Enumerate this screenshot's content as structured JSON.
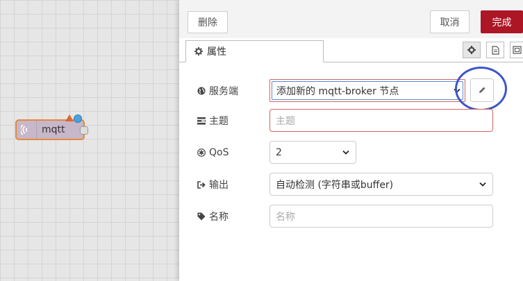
{
  "workspace": {
    "node_label": "mqtt"
  },
  "header": {
    "delete_label": "删除",
    "cancel_label": "取消",
    "done_label": "完成"
  },
  "tabs": {
    "properties_label": "属性"
  },
  "form": {
    "server": {
      "label": "服务端",
      "value": "添加新的 mqtt-broker 节点"
    },
    "topic": {
      "label": "主题",
      "placeholder": "主题"
    },
    "qos": {
      "label": "QoS",
      "value": "2"
    },
    "output": {
      "label": "输出",
      "value": "自动检测 (字符串或buffer)"
    },
    "name": {
      "label": "名称",
      "placeholder": "名称"
    }
  },
  "colors": {
    "done_button": "#ad1625",
    "error_border": "#d6615e",
    "node_fill": "#c8b6c9",
    "node_border": "#e08a3c",
    "annotation_ring": "#3b56c8"
  },
  "icons": [
    "wifi-icon",
    "warning-icon",
    "status-dot",
    "gear-icon",
    "file-icon",
    "layout-icon",
    "globe-icon",
    "tasks-icon",
    "asterisk-icon",
    "sign-out-icon",
    "tag-icon",
    "pencil-icon",
    "chevron-down-icon"
  ]
}
